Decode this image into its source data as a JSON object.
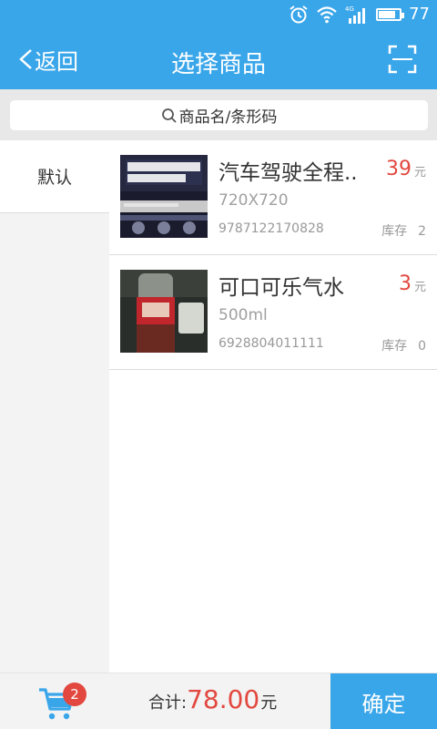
{
  "status_bar": {
    "battery_level": "77",
    "icons": [
      "alarm-icon",
      "wifi-icon",
      "4g-signal-icon",
      "battery-icon"
    ]
  },
  "header": {
    "back_label": "返回",
    "title": "选择商品",
    "scan_icon": "scan-icon"
  },
  "search": {
    "placeholder": "商品名/条形码"
  },
  "categories": [
    {
      "label": "默认",
      "selected": true
    }
  ],
  "products": [
    {
      "name": "汽车驾驶全程..",
      "spec": "720X720",
      "barcode": "9787122170828",
      "price": "39",
      "unit": "元",
      "stock_label": "库存",
      "stock": "2"
    },
    {
      "name": "可口可乐气水",
      "spec": "500ml",
      "barcode": "6928804011111",
      "price": "3",
      "unit": "元",
      "stock_label": "库存",
      "stock": "0"
    }
  ],
  "footer": {
    "cart_count": "2",
    "total_label": "合计:",
    "total_amount": "78.00",
    "currency": "元",
    "confirm_label": "确定"
  },
  "colors": {
    "primary": "#3aa6ea",
    "price_red": "#e2483f",
    "badge_red": "#e2483f"
  }
}
